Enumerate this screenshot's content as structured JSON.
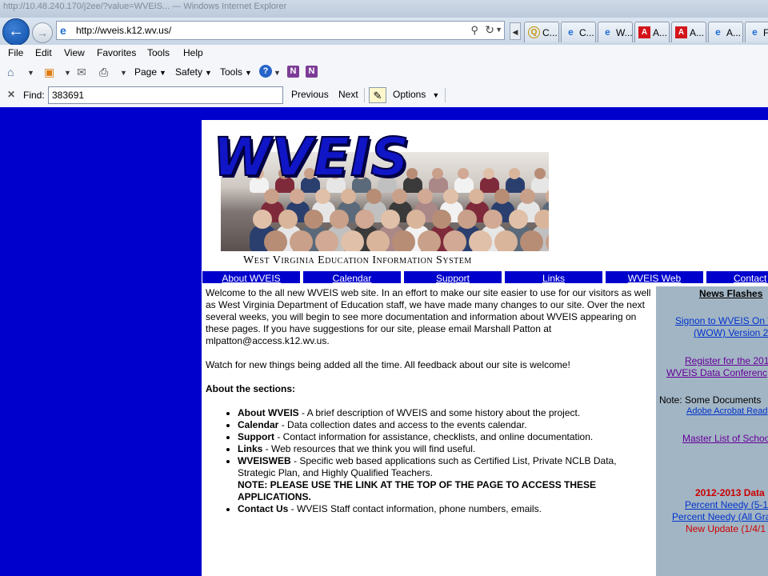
{
  "browser": {
    "title_text": "http://10.48.240.170/j2ee/?value=WVEIS...  — Windows Internet Explorer",
    "address": "http://wveis.k12.wv.us/",
    "tabs": [
      {
        "icon": "q",
        "label": "C..."
      },
      {
        "icon": "ie",
        "label": "C..."
      },
      {
        "icon": "ie",
        "label": "W..."
      },
      {
        "icon": "adobe",
        "label": "A..."
      },
      {
        "icon": "adobe",
        "label": "A..."
      },
      {
        "icon": "ie",
        "label": "A..."
      },
      {
        "icon": "ie",
        "label": "F..."
      }
    ],
    "menu": [
      "File",
      "Edit",
      "View",
      "Favorites",
      "Tools",
      "Help"
    ],
    "commands": {
      "page": "Page",
      "safety": "Safety",
      "tools": "Tools"
    },
    "find": {
      "label": "Find:",
      "value": "383691",
      "prev": "Previous",
      "next": "Next",
      "options": "Options"
    }
  },
  "site": {
    "logo": "WVEIS",
    "caption": "West Virginia Education Information System",
    "nav": [
      "About WVEIS",
      "Calendar",
      "Support",
      "Links",
      "WVEIS Web",
      "Contact"
    ],
    "welcome": "Welcome to the all new WVEIS web site.  In an effort to make our site easier to use for our visitors as well as West Virginia Department of Education staff, we have made many changes to our site.  Over the next several weeks, you will begin to see more documentation and information about WVEIS appearing on these pages.  If you have suggestions for our site, please email Marshall Patton at mlpatton@access.k12.wv.us.",
    "watch": "Watch for new things being added all the time.  All feedback about our site is welcome!",
    "sections_title": "About the sections:",
    "sections": [
      {
        "name": "About WVEIS",
        "desc": " - A brief description of WVEIS and some history about the project."
      },
      {
        "name": "Calendar",
        "desc": " - Data collection dates and access to the events calendar."
      },
      {
        "name": "Support",
        "desc": " - Contact information for assistance, checklists, and online documentation."
      },
      {
        "name": "Links",
        "desc": " - Web resources that we think you will find useful."
      },
      {
        "name": "WVEISWEB",
        "desc": " - Specific web based applications such as Certified List, Private NCLB Data, Strategic Plan, and Highly Qualified Teachers."
      },
      {
        "name": "Contact Us",
        "desc": " - WVEIS Staff contact information, phone numbers, emails."
      }
    ],
    "wveisweb_note": "NOTE: PLEASE USE THE LINK AT THE TOP OF THE PAGE TO ACCESS THESE APPLICATIONS.",
    "sidebar": {
      "title": "News Flashes",
      "signon_line1": "Signon to WVEIS On W",
      "signon_line2": "(WOW) Version 2",
      "register_line1": "Register for the 201",
      "register_line2": "WVEIS Data Conferenc",
      "note": "Note: Some Documents",
      "adobe": "Adobe Acrobat Read",
      "master": "Master List of Schoo",
      "data_heading": "2012-2013 Data",
      "pct1": "Percent Needy (5-1",
      "pct2": "Percent Needy (All Gra",
      "new_update": "New Update (1/4/1"
    }
  }
}
